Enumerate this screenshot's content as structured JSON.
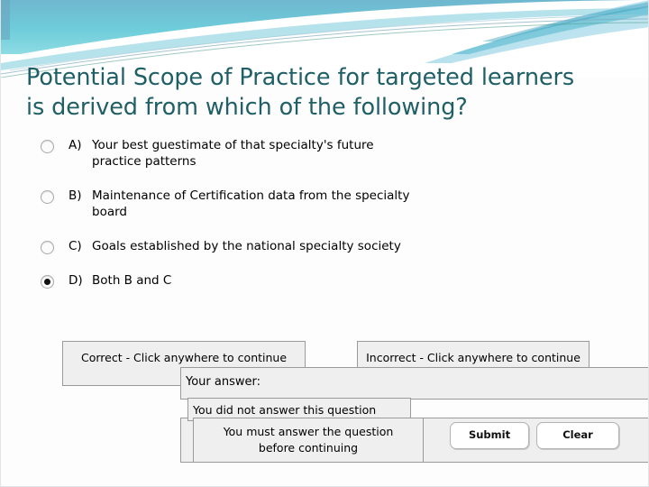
{
  "slide": {
    "title_line1": "Potential Scope of Practice for targeted learners",
    "title_line2": "is derived from which of the following?",
    "title_color": "#1f5f66",
    "background_color": "#fdfdfd"
  },
  "header_art": {
    "name": "decorative-wave-banner",
    "colors": {
      "teal_dark": "#3aa9bd",
      "teal_light": "#7fd3de",
      "cyan": "#46c3d4",
      "sky": "#8fcfe6",
      "steel": "#6b93b0",
      "white": "#ffffff"
    }
  },
  "quiz": {
    "options": [
      {
        "letter": "A)",
        "text_line1": "Your best guestimate of that specialty's future",
        "text_line2": "practice patterns",
        "selected": false
      },
      {
        "letter": "B)",
        "text_line1": "Maintenance of Certification data from the specialty",
        "text_line2": "board",
        "selected": false
      },
      {
        "letter": "C)",
        "text_line1": "Goals established by the national specialty society",
        "text_line2": "",
        "selected": false
      },
      {
        "letter": "D)",
        "text_line1": "Both B and C",
        "text_line2": "",
        "selected": true
      }
    ]
  },
  "feedback": {
    "correct_message": "Correct - Click anywhere to continue",
    "incorrect_message": "Incorrect - Click anywhere to continue",
    "your_answer_label": "Your answer:",
    "not_answered_message": "You did not answer this question",
    "must_answer_line1": "You must answer the question",
    "must_answer_line2": "before continuing"
  },
  "buttons": {
    "submit_label": "Submit",
    "clear_label": "Clear"
  }
}
